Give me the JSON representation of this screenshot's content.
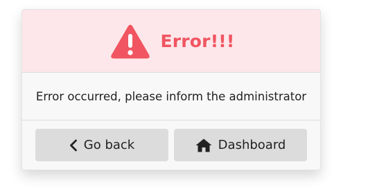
{
  "dialog": {
    "title": "Error!!!",
    "title_icon": "warning-triangle-icon",
    "message": "Error occurred, please inform the administrator",
    "buttons": {
      "back_label": "Go back",
      "back_icon": "chevron-left-icon",
      "dashboard_label": "Dashboard",
      "dashboard_icon": "home-icon"
    }
  },
  "colors": {
    "header_bg": "#fde7ea",
    "accent": "#f05561",
    "button_bg": "#dcdcdc"
  }
}
